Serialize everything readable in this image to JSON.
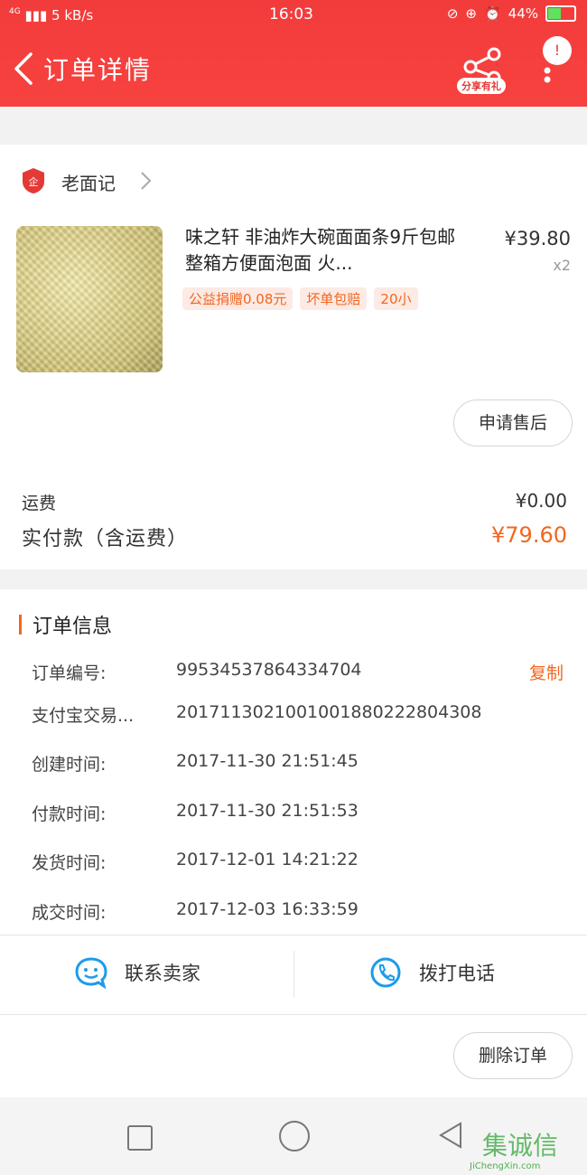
{
  "status_bar": {
    "network": "4G",
    "speed": "5 kB/s",
    "time": "16:03",
    "battery": "44%"
  },
  "header": {
    "title": "订单详情",
    "share_label": "分享有礼",
    "badge": "!"
  },
  "shop": {
    "name": "老面记"
  },
  "product": {
    "title": "味之轩 非油炸大碗面面条9斤包邮整箱方便面泡面 火...",
    "price": "¥39.80",
    "qty": "x2",
    "tags": [
      "公益捐赠0.08元",
      "坏单包赔",
      "20小"
    ]
  },
  "buttons": {
    "after_sale": "申请售后",
    "delete_order": "删除订单"
  },
  "payment": {
    "shipping_label": "运费",
    "shipping_value": "¥0.00",
    "actual_label": "实付款（含运费）",
    "actual_value": "¥79.60"
  },
  "order_info": {
    "title": "订单信息",
    "copy_label": "复制",
    "rows": [
      {
        "label": "订单编号:",
        "value": "99534537864334704"
      },
      {
        "label": "支付宝交易...",
        "value": "2017113021001001880222804308"
      },
      {
        "label": "创建时间:",
        "value": "2017-11-30 21:51:45"
      },
      {
        "label": "付款时间:",
        "value": "2017-11-30 21:51:53"
      },
      {
        "label": "发货时间:",
        "value": "2017-12-01 14:21:22"
      },
      {
        "label": "成交时间:",
        "value": "2017-12-03 16:33:59"
      }
    ]
  },
  "actions": {
    "contact_seller": "联系卖家",
    "call_phone": "拨打电话"
  },
  "watermark": {
    "text": "集诚信",
    "sub": "JiChengXin.com"
  },
  "colors": {
    "brand_red": "#f23c3c",
    "accent_orange": "#f2661f",
    "action_blue": "#1e9be9"
  }
}
